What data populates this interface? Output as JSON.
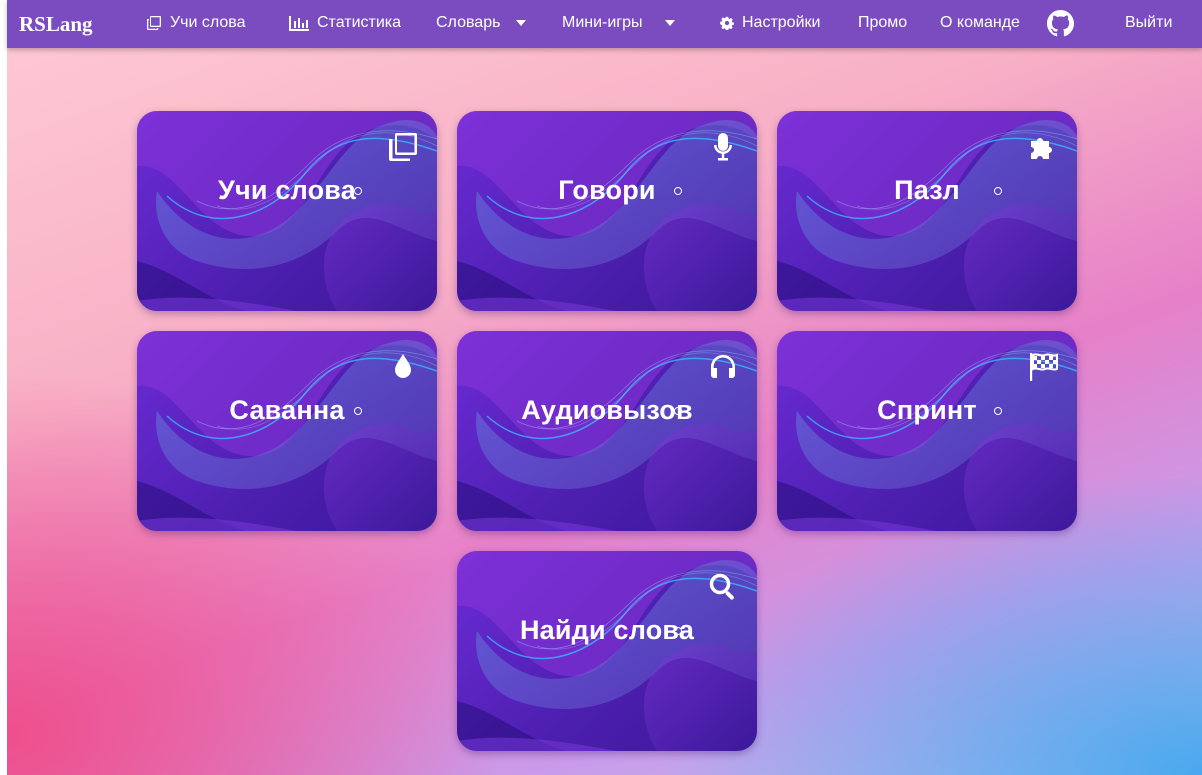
{
  "brand": "RSLang",
  "nav": {
    "learn": "Учи слова",
    "stats": "Статистика",
    "dictionary": "Словарь",
    "minigames": "Мини-игры",
    "settings": "Настройки",
    "promo": "Промо",
    "team": "О команде",
    "logout": "Выйти"
  },
  "cards": [
    {
      "title": "Учи слова",
      "icon": "copy-icon"
    },
    {
      "title": "Говори",
      "icon": "microphone-icon"
    },
    {
      "title": "Пазл",
      "icon": "puzzle-icon"
    },
    {
      "title": "Саванна",
      "icon": "drop-icon"
    },
    {
      "title": "Аудиовызов",
      "icon": "headphones-icon"
    },
    {
      "title": "Спринт",
      "icon": "flag-checkered-icon"
    },
    {
      "title": "Найди слова",
      "icon": "search-icon"
    }
  ],
  "colors": {
    "navbar": "#7a4cc0",
    "card": "#4d1fb0",
    "card_accent": "#6c2bd6"
  }
}
